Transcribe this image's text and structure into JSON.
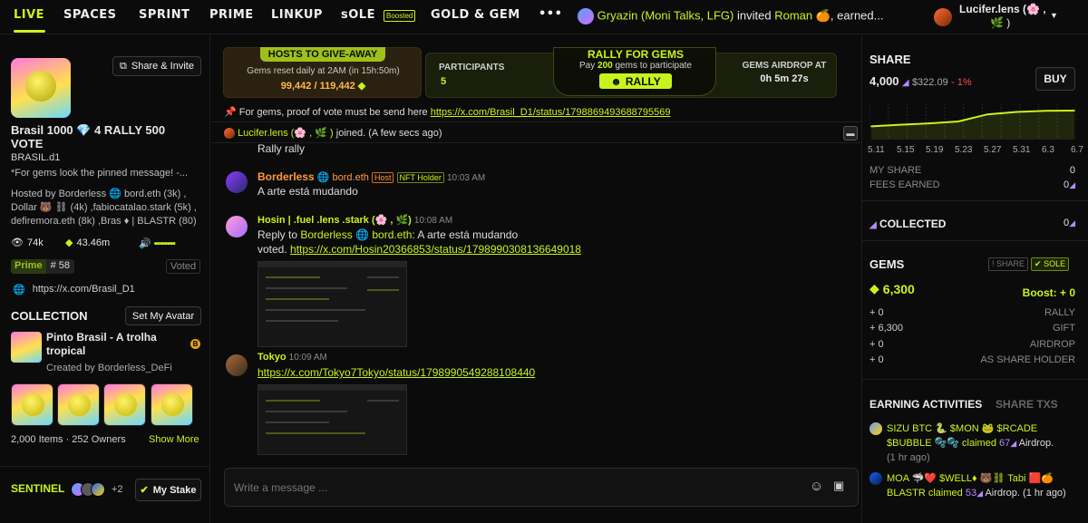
{
  "nav": {
    "tabs": [
      "LIVE",
      "SPACES",
      "SPRINT",
      "PRIME",
      "LINKUP",
      "sOLE",
      "GOLD & GEM"
    ],
    "boosted": "Boosted",
    "more": "•••",
    "ticker": {
      "user": "Gryazin (Moni Talks, LFG)",
      "action": "invited",
      "target": "Roman",
      "tail": "🍊, earned..."
    },
    "current_user": {
      "name": "Lucifer.lens (🌸 ,",
      "line2": "🌿 )"
    }
  },
  "room": {
    "title": "Brasil 1000 💎 4 RALLY 500 VOTE",
    "handle": "BRASIL.d1",
    "share_button": "Share & Invite",
    "desc": "*For gems look the pinned message! -...",
    "hosted": "Hosted by Borderless 🌐 bord.eth (3k) , Dollar 🐻 ⛓ (4k) ,fabiocatalao.stark (5k) , defiremora.eth (8k) ,Bras ♦ | BLASTR (80)",
    "views": "74k",
    "gems": "43.46m",
    "prime_label": "Prime",
    "prime_rank": "# 58",
    "voted": "Voted",
    "link": "https://x.com/Brasil_D1"
  },
  "collection": {
    "title": "COLLECTION",
    "set_avatar": "Set My Avatar",
    "name": "Pinto Brasil - A trolha tropical",
    "creator": "Created by Borderless_DeFi",
    "items_count": "2,000",
    "items_label": "Items",
    "dot": "·",
    "owners_count": "252",
    "owners_label": "Owners",
    "show_more": "Show More"
  },
  "sentinel": {
    "label": "SENTINEL",
    "extra": "+2",
    "stake_button": "My Stake"
  },
  "banner": {
    "hosts_title": "HOSTS TO GIVE-AWAY",
    "hosts_sub": "Gems reset daily at 2AM (in 15h:50m)",
    "hosts_value": "99,442 / 119,442",
    "participants_label": "PARTICIPANTS",
    "participants_value": "5",
    "rally_title": "RALLY FOR GEMS",
    "rally_sub_pre": "Pay",
    "rally_sub_amount": "200",
    "rally_sub_post": "gems to participate",
    "rally_button": "RALLY",
    "airdrop_label": "GEMS AIRDROP AT",
    "airdrop_value": "0h 5m 27s"
  },
  "pinned": {
    "text": "For gems, proof of vote must be send here",
    "link": "https://x.com/Brasil_D1/status/1798869493688795569"
  },
  "joined": {
    "name": "Lucifer.lens (🌸 , 🌿 )",
    "text": "joined. (A few secs ago)"
  },
  "messages": [
    {
      "text": "Rally rally"
    },
    {
      "name": "Borderless",
      "handle": "🌐 bord.eth",
      "tag1": "Host",
      "tag2": "NFT Holder",
      "time": "10:03 AM",
      "text": "A arte está mudando"
    },
    {
      "name": "Hosin | .fuel .lens .stark (🌸 , 🌿)",
      "time": "10:08 AM",
      "reply_pre": "Reply to",
      "reply_to": "Borderless",
      "reply_handle": "🌐 bord.eth:",
      "reply_text": "A arte está mudando",
      "text": "voted.",
      "link": "https://x.com/Hosin20366853/status/1798990308136649018"
    },
    {
      "name": "Tokyo",
      "time": "10:09 AM",
      "link": "https://x.com/Tokyo7Tokyo/status/1798990549288108440"
    }
  ],
  "composer": {
    "placeholder": "Write a message ..."
  },
  "share": {
    "title": "SHARE",
    "value": "4,000",
    "usd": "$322.09",
    "change": "- 1%",
    "buy": "BUY",
    "x_ticks": [
      "5.11",
      "5.15",
      "5.19",
      "5.23",
      "5.27",
      "5.31",
      "6.3",
      "6.7"
    ],
    "my_share_label": "MY SHARE",
    "my_share": "0",
    "fees_label": "FEES EARNED",
    "fees": "0"
  },
  "collected": {
    "title": "COLLECTED",
    "value": "0"
  },
  "gems_panel": {
    "title": "GEMS",
    "share_toggle": "SHARE",
    "sole_toggle": "SOLE",
    "value": "6,300",
    "boost": "Boost: + 0",
    "rows": [
      {
        "v": "+ 0",
        "l": "RALLY"
      },
      {
        "v": "+ 6,300",
        "l": "GIFT"
      },
      {
        "v": "+ 0",
        "l": "AIRDROP"
      },
      {
        "v": "+ 0",
        "l": "AS SHARE HOLDER"
      }
    ]
  },
  "earning": {
    "tab1": "EARNING ACTIVITIES",
    "tab2": "SHARE TXS",
    "items": [
      {
        "l1": "SIZU BTC 🐍 $MON 🐸 $RCADE",
        "l2": "$BUBBLE 🫧🫧 claimed",
        "amount": "67",
        "l2b": "Airdrop.",
        "l3": "(1 hr ago)"
      },
      {
        "l1": "MOA 🦈❤️ $WELL♦ 🐻⛓ Tabi 🟥🍊",
        "l2": "BLASTR claimed",
        "amount": "53",
        "l2b": "Airdrop. (1 hr ago)"
      }
    ]
  },
  "chart_data": {
    "type": "area",
    "x": [
      "5.11",
      "5.15",
      "5.19",
      "5.23",
      "5.27",
      "5.31",
      "6.3",
      "6.7"
    ],
    "values": [
      3420,
      3480,
      3530,
      3600,
      3860,
      3950,
      3990,
      4000
    ],
    "ylim": [
      3000,
      4200
    ]
  },
  "colors": {
    "accent": "#c9f31d",
    "bg": "#0b0b0b",
    "panel": "#141414",
    "negative": "#ff4d4d"
  }
}
